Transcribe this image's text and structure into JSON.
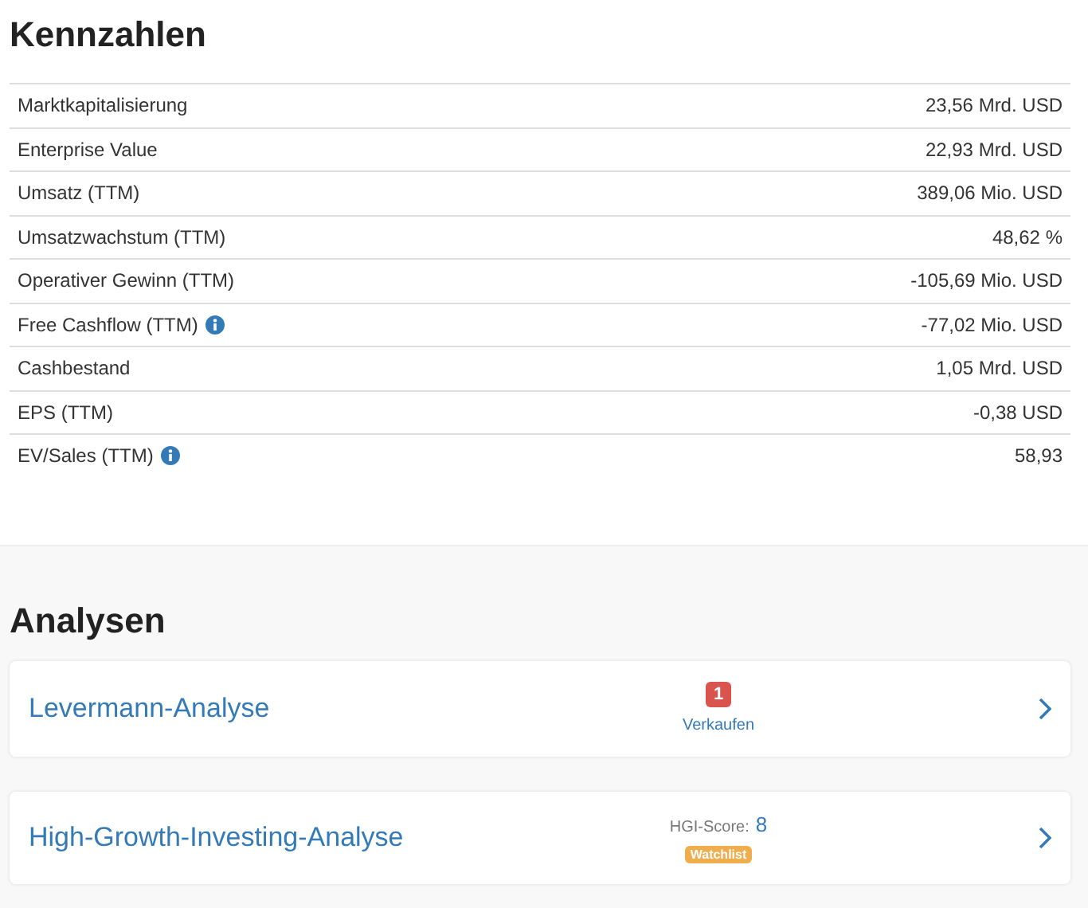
{
  "kennzahlen": {
    "title": "Kennzahlen",
    "rows": [
      {
        "label": "Marktkapitalisierung",
        "value": "23,56 Mrd. USD",
        "info": false
      },
      {
        "label": "Enterprise Value",
        "value": "22,93 Mrd. USD",
        "info": false
      },
      {
        "label": "Umsatz (TTM)",
        "value": "389,06 Mio. USD",
        "info": false
      },
      {
        "label": "Umsatzwachstum (TTM)",
        "value": "48,62 %",
        "info": false
      },
      {
        "label": "Operativer Gewinn (TTM)",
        "value": "-105,69 Mio. USD",
        "info": false
      },
      {
        "label": "Free Cashflow (TTM)",
        "value": "-77,02 Mio. USD",
        "info": true
      },
      {
        "label": "Cashbestand",
        "value": "1,05 Mrd. USD",
        "info": false
      },
      {
        "label": "EPS (TTM)",
        "value": "-0,38 USD",
        "info": false
      },
      {
        "label": "EV/Sales (TTM)",
        "value": "58,93",
        "info": true
      }
    ]
  },
  "analysen": {
    "title": "Analysen",
    "items": [
      {
        "kind": "rating",
        "name": "Levermann-Analyse",
        "badge": "1",
        "color": "#d9534f",
        "caption": "Verkaufen"
      },
      {
        "kind": "score",
        "name": "High-Growth-Investing-Analyse",
        "score_label": "HGI-Score:",
        "score": "8",
        "badge": "Watchlist",
        "color": "#f0ad4e"
      }
    ]
  }
}
